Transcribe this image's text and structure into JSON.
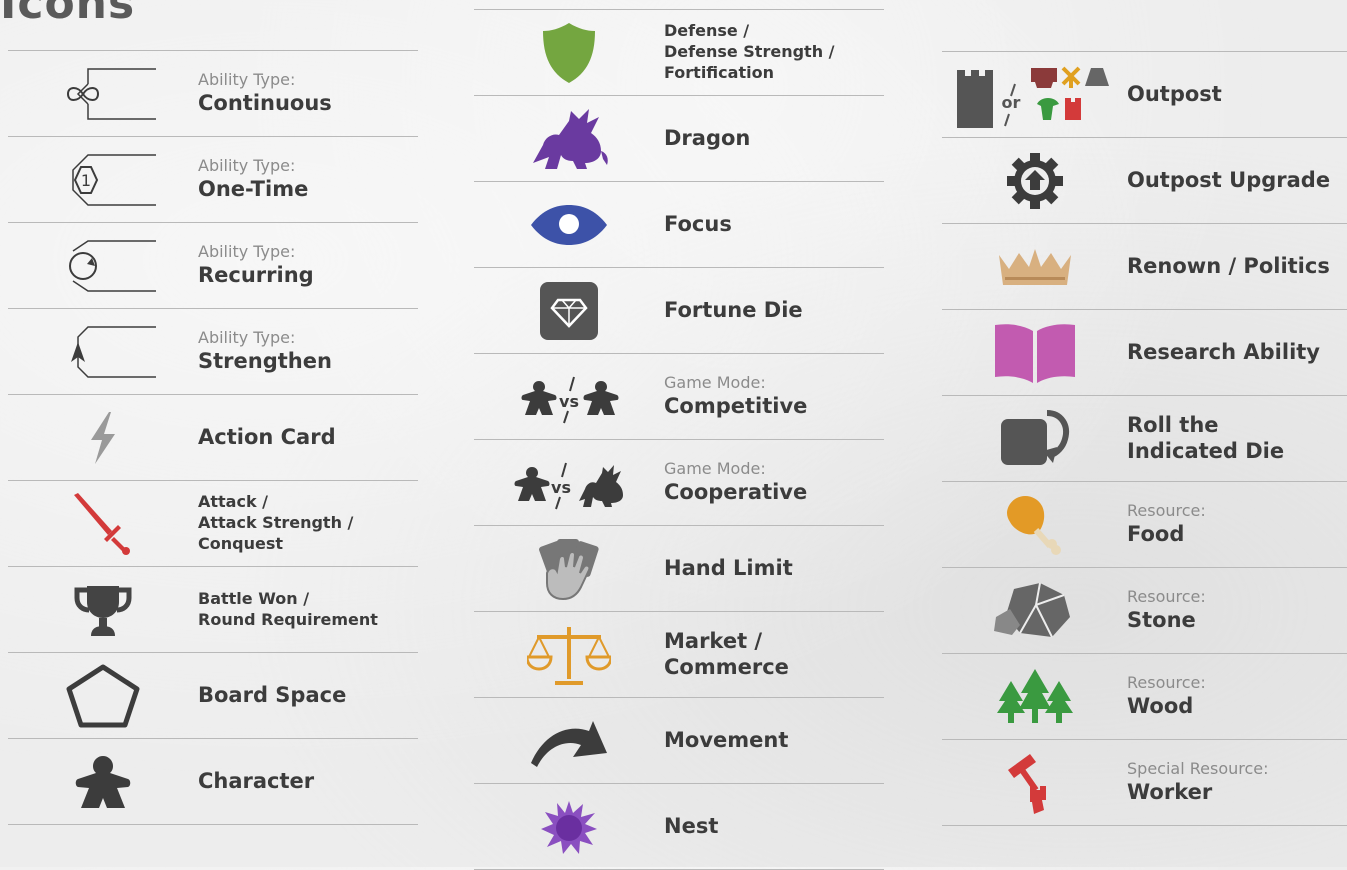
{
  "title": "Icons",
  "col1": [
    {
      "sub": "Ability Type:",
      "main": "Continuous"
    },
    {
      "sub": "Ability Type:",
      "main": "One-Time"
    },
    {
      "sub": "Ability Type:",
      "main": "Recurring"
    },
    {
      "sub": "Ability Type:",
      "main": "Strengthen"
    },
    {
      "main": "Action Card"
    },
    {
      "lines": [
        "Attack /",
        "Attack Strength /",
        "Conquest"
      ]
    },
    {
      "lines": [
        "Battle Won /",
        "Round Requirement"
      ]
    },
    {
      "main": "Board Space"
    },
    {
      "main": "Character"
    }
  ],
  "col2": [
    {
      "lines": [
        "Defense /",
        "Defense Strength /",
        "Fortification"
      ]
    },
    {
      "main": "Dragon"
    },
    {
      "main": "Focus"
    },
    {
      "main": "Fortune Die"
    },
    {
      "sub": "Game Mode:",
      "main": "Competitive"
    },
    {
      "sub": "Game Mode:",
      "main": "Cooperative"
    },
    {
      "main": "Hand Limit"
    },
    {
      "main": "Market /",
      "main2": "Commerce"
    },
    {
      "main": "Movement"
    },
    {
      "main": "Nest"
    }
  ],
  "col3": [
    {
      "main": "Outpost"
    },
    {
      "main": "Outpost Upgrade"
    },
    {
      "main": "Renown / Politics"
    },
    {
      "main": "Research Ability"
    },
    {
      "main": "Roll the",
      "main2": "Indicated Die"
    },
    {
      "sub": "Resource:",
      "main": "Food"
    },
    {
      "sub": "Resource:",
      "main": "Stone"
    },
    {
      "sub": "Resource:",
      "main": "Wood"
    },
    {
      "sub": "Special Resource:",
      "main": "Worker"
    }
  ],
  "glyphs": {
    "one_time": "1",
    "vs": "vs",
    "or": "or"
  },
  "colors": {
    "defense": "#74a640",
    "dragon": "#6a3aa0",
    "focus": "#3d52a8",
    "attack": "#d33a3a",
    "renown": "#d8b080",
    "research": "#c25bb0",
    "market": "#e09a2a",
    "food": "#e39a26",
    "wood": "#3a9a40",
    "worker": "#d33a3a",
    "dark": "#555555",
    "nest": "#8a4fc0"
  }
}
